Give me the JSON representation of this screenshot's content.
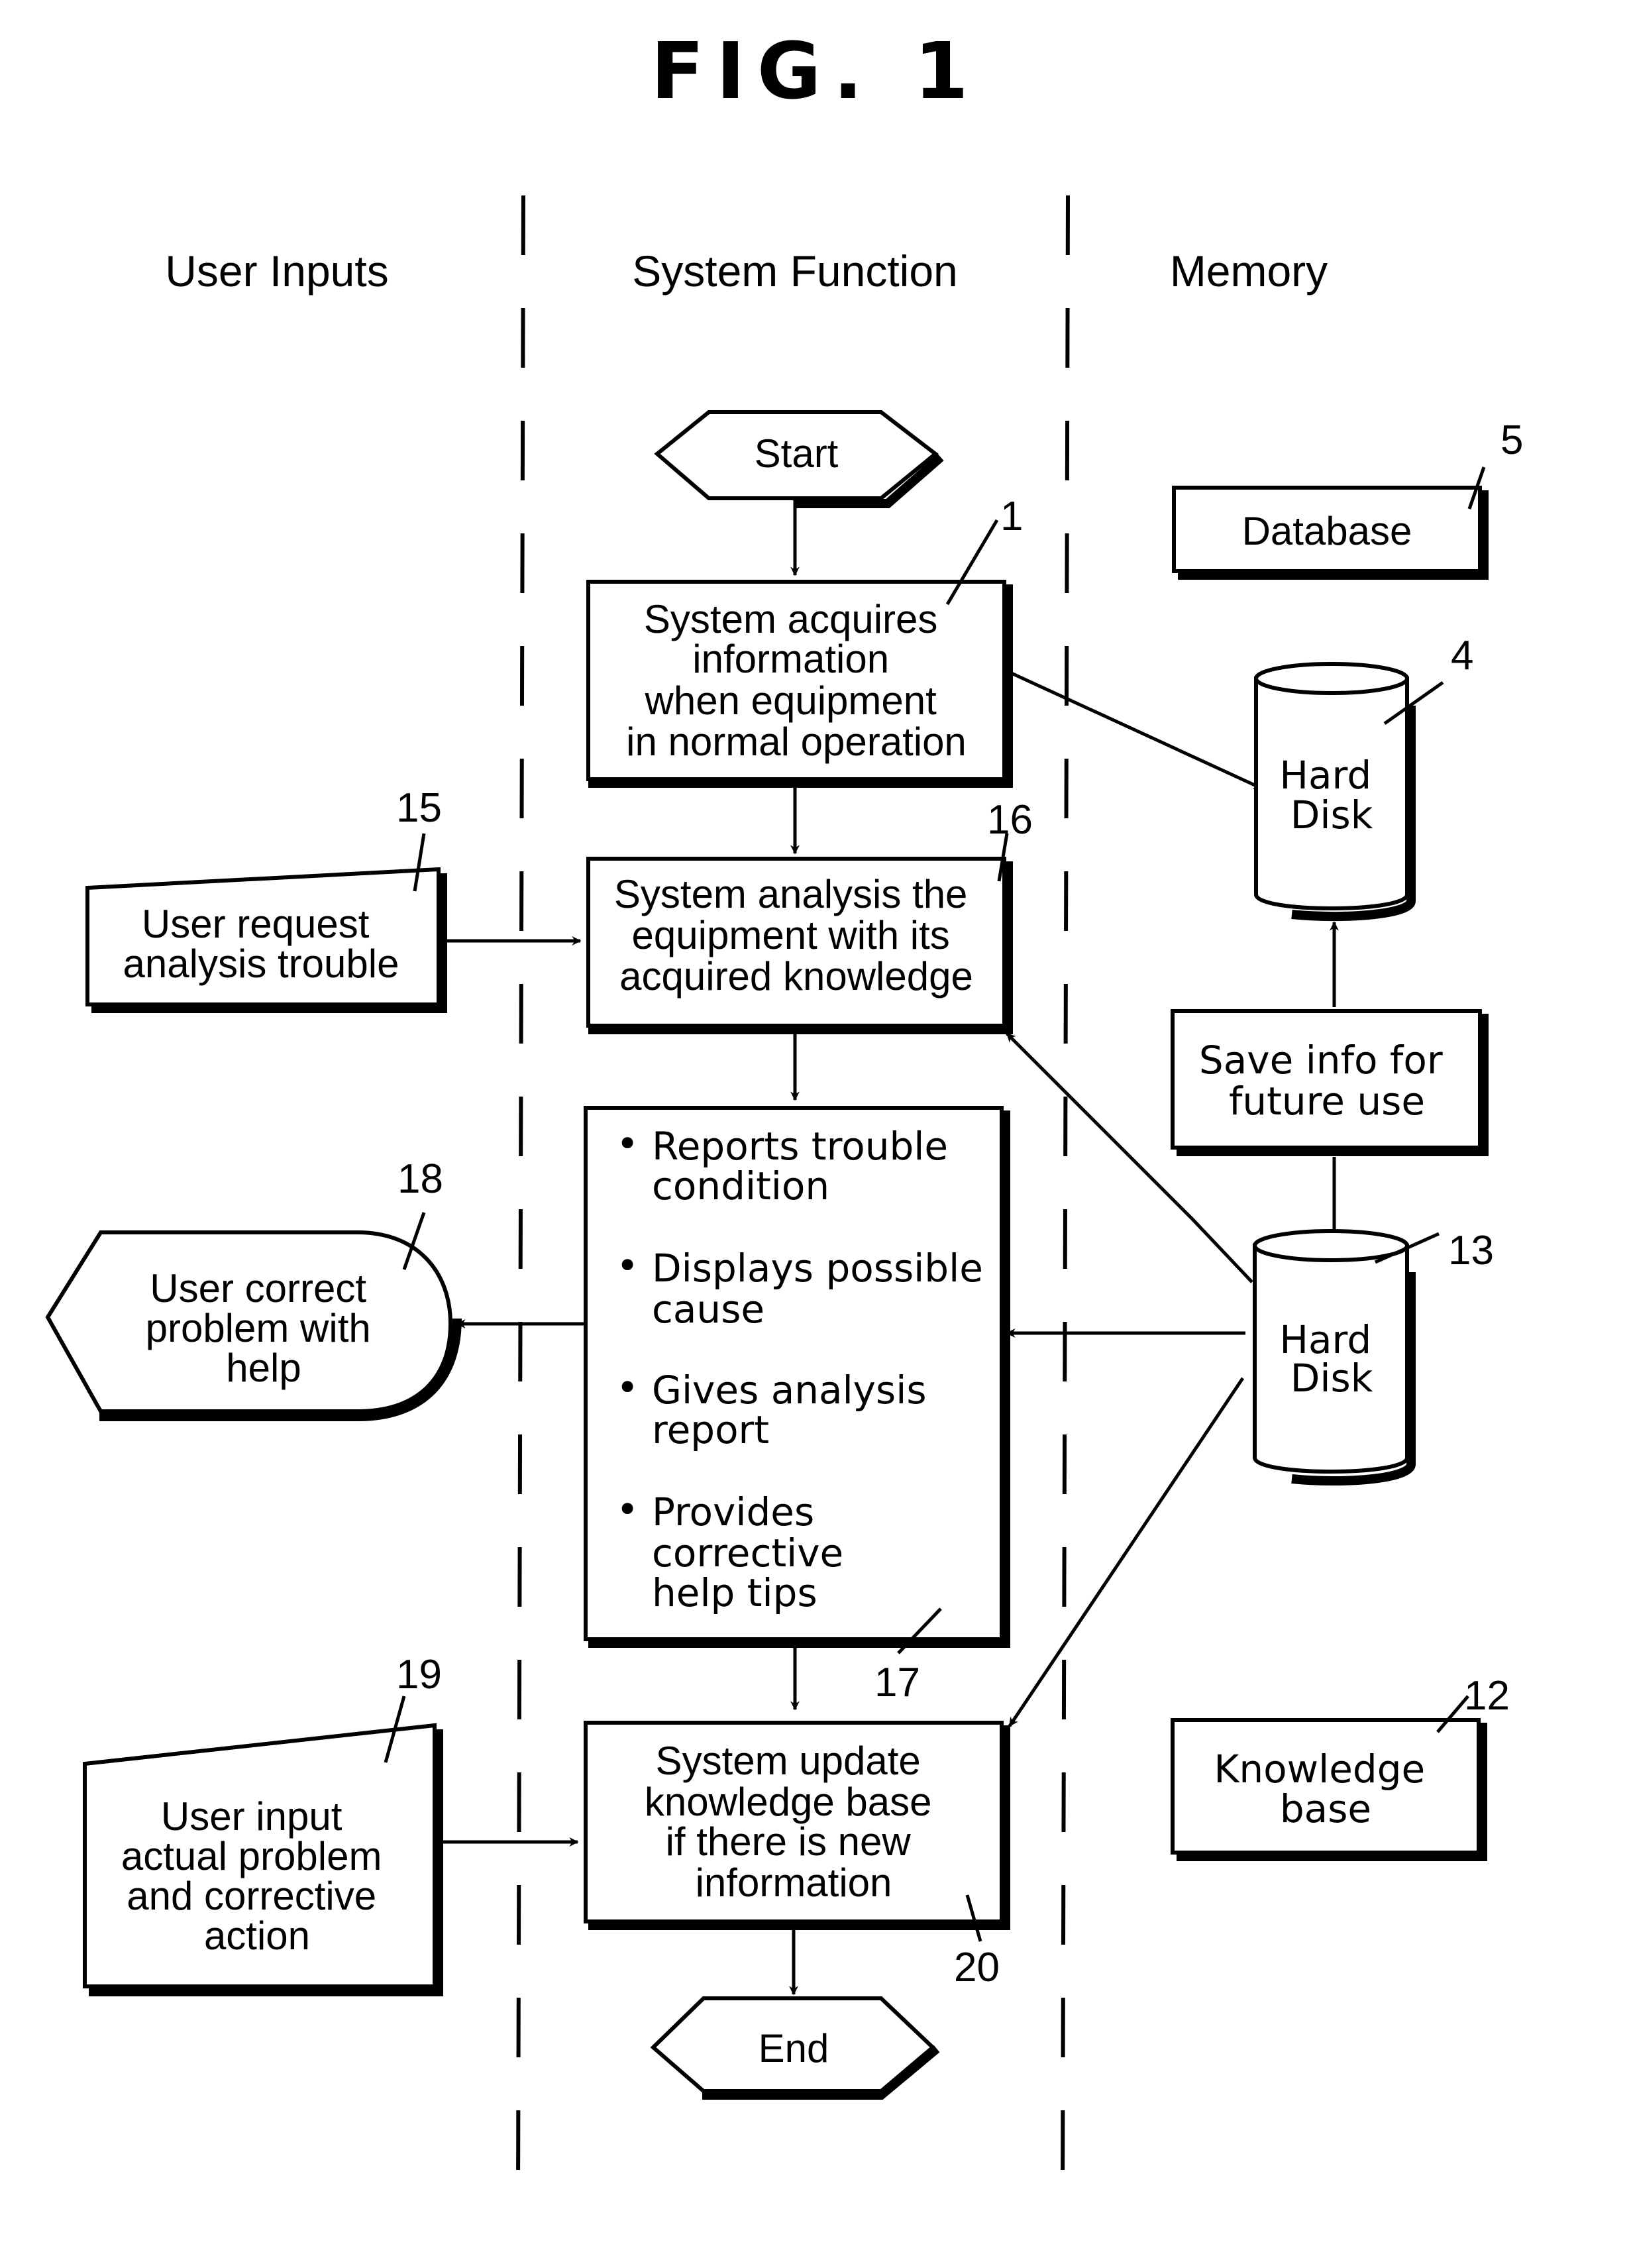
{
  "figure": {
    "title": "FIG. 1",
    "lanes": [
      "User Inputs",
      "System Function",
      "Memory"
    ]
  },
  "nodes": {
    "start": {
      "label": "Start"
    },
    "end": {
      "label": "End"
    },
    "acquire": {
      "ref": "1",
      "lines": [
        "System acquires",
        "information",
        "when equipment",
        "in normal operation"
      ]
    },
    "analysis": {
      "ref": "16",
      "lines": [
        "System analysis the",
        "equipment with its",
        "acquired knowledge"
      ]
    },
    "report": {
      "ref": "17",
      "bullets": [
        [
          "Reports trouble",
          "condition"
        ],
        [
          "Displays possible",
          "cause"
        ],
        [
          "Gives analysis",
          "report"
        ],
        [
          "Provides",
          "corrective",
          "help tips"
        ]
      ]
    },
    "update": {
      "ref": "20",
      "lines": [
        "System update",
        "knowledge base",
        "if there is new",
        "information"
      ]
    },
    "user_request": {
      "ref": "15",
      "lines": [
        "User request",
        "analysis trouble"
      ]
    },
    "user_correct": {
      "ref": "18",
      "lines": [
        "User correct",
        "problem with",
        "help"
      ]
    },
    "user_input": {
      "ref": "19",
      "lines": [
        "User  input",
        "actual problem",
        "and corrective",
        "action"
      ]
    },
    "database": {
      "ref": "5",
      "label": "Database"
    },
    "hard_disk_1": {
      "ref": "4",
      "lines": [
        "Hard",
        "Disk"
      ]
    },
    "save_info": {
      "lines": [
        "Save info for",
        "future use"
      ]
    },
    "hard_disk_2": {
      "ref": "13",
      "lines": [
        "Hard",
        "Disk"
      ]
    },
    "knowledge_base": {
      "ref": "12",
      "lines": [
        "Knowledge",
        "base"
      ]
    }
  },
  "bullet_glyph": "•"
}
